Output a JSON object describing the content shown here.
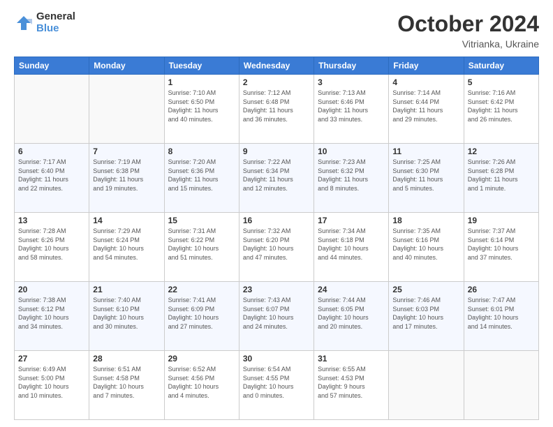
{
  "logo": {
    "general": "General",
    "blue": "Blue"
  },
  "header": {
    "month": "October 2024",
    "location": "Vitrianka, Ukraine"
  },
  "weekdays": [
    "Sunday",
    "Monday",
    "Tuesday",
    "Wednesday",
    "Thursday",
    "Friday",
    "Saturday"
  ],
  "weeks": [
    [
      {
        "day": "",
        "info": ""
      },
      {
        "day": "",
        "info": ""
      },
      {
        "day": "1",
        "info": "Sunrise: 7:10 AM\nSunset: 6:50 PM\nDaylight: 11 hours\nand 40 minutes."
      },
      {
        "day": "2",
        "info": "Sunrise: 7:12 AM\nSunset: 6:48 PM\nDaylight: 11 hours\nand 36 minutes."
      },
      {
        "day": "3",
        "info": "Sunrise: 7:13 AM\nSunset: 6:46 PM\nDaylight: 11 hours\nand 33 minutes."
      },
      {
        "day": "4",
        "info": "Sunrise: 7:14 AM\nSunset: 6:44 PM\nDaylight: 11 hours\nand 29 minutes."
      },
      {
        "day": "5",
        "info": "Sunrise: 7:16 AM\nSunset: 6:42 PM\nDaylight: 11 hours\nand 26 minutes."
      }
    ],
    [
      {
        "day": "6",
        "info": "Sunrise: 7:17 AM\nSunset: 6:40 PM\nDaylight: 11 hours\nand 22 minutes."
      },
      {
        "day": "7",
        "info": "Sunrise: 7:19 AM\nSunset: 6:38 PM\nDaylight: 11 hours\nand 19 minutes."
      },
      {
        "day": "8",
        "info": "Sunrise: 7:20 AM\nSunset: 6:36 PM\nDaylight: 11 hours\nand 15 minutes."
      },
      {
        "day": "9",
        "info": "Sunrise: 7:22 AM\nSunset: 6:34 PM\nDaylight: 11 hours\nand 12 minutes."
      },
      {
        "day": "10",
        "info": "Sunrise: 7:23 AM\nSunset: 6:32 PM\nDaylight: 11 hours\nand 8 minutes."
      },
      {
        "day": "11",
        "info": "Sunrise: 7:25 AM\nSunset: 6:30 PM\nDaylight: 11 hours\nand 5 minutes."
      },
      {
        "day": "12",
        "info": "Sunrise: 7:26 AM\nSunset: 6:28 PM\nDaylight: 11 hours\nand 1 minute."
      }
    ],
    [
      {
        "day": "13",
        "info": "Sunrise: 7:28 AM\nSunset: 6:26 PM\nDaylight: 10 hours\nand 58 minutes."
      },
      {
        "day": "14",
        "info": "Sunrise: 7:29 AM\nSunset: 6:24 PM\nDaylight: 10 hours\nand 54 minutes."
      },
      {
        "day": "15",
        "info": "Sunrise: 7:31 AM\nSunset: 6:22 PM\nDaylight: 10 hours\nand 51 minutes."
      },
      {
        "day": "16",
        "info": "Sunrise: 7:32 AM\nSunset: 6:20 PM\nDaylight: 10 hours\nand 47 minutes."
      },
      {
        "day": "17",
        "info": "Sunrise: 7:34 AM\nSunset: 6:18 PM\nDaylight: 10 hours\nand 44 minutes."
      },
      {
        "day": "18",
        "info": "Sunrise: 7:35 AM\nSunset: 6:16 PM\nDaylight: 10 hours\nand 40 minutes."
      },
      {
        "day": "19",
        "info": "Sunrise: 7:37 AM\nSunset: 6:14 PM\nDaylight: 10 hours\nand 37 minutes."
      }
    ],
    [
      {
        "day": "20",
        "info": "Sunrise: 7:38 AM\nSunset: 6:12 PM\nDaylight: 10 hours\nand 34 minutes."
      },
      {
        "day": "21",
        "info": "Sunrise: 7:40 AM\nSunset: 6:10 PM\nDaylight: 10 hours\nand 30 minutes."
      },
      {
        "day": "22",
        "info": "Sunrise: 7:41 AM\nSunset: 6:09 PM\nDaylight: 10 hours\nand 27 minutes."
      },
      {
        "day": "23",
        "info": "Sunrise: 7:43 AM\nSunset: 6:07 PM\nDaylight: 10 hours\nand 24 minutes."
      },
      {
        "day": "24",
        "info": "Sunrise: 7:44 AM\nSunset: 6:05 PM\nDaylight: 10 hours\nand 20 minutes."
      },
      {
        "day": "25",
        "info": "Sunrise: 7:46 AM\nSunset: 6:03 PM\nDaylight: 10 hours\nand 17 minutes."
      },
      {
        "day": "26",
        "info": "Sunrise: 7:47 AM\nSunset: 6:01 PM\nDaylight: 10 hours\nand 14 minutes."
      }
    ],
    [
      {
        "day": "27",
        "info": "Sunrise: 6:49 AM\nSunset: 5:00 PM\nDaylight: 10 hours\nand 10 minutes."
      },
      {
        "day": "28",
        "info": "Sunrise: 6:51 AM\nSunset: 4:58 PM\nDaylight: 10 hours\nand 7 minutes."
      },
      {
        "day": "29",
        "info": "Sunrise: 6:52 AM\nSunset: 4:56 PM\nDaylight: 10 hours\nand 4 minutes."
      },
      {
        "day": "30",
        "info": "Sunrise: 6:54 AM\nSunset: 4:55 PM\nDaylight: 10 hours\nand 0 minutes."
      },
      {
        "day": "31",
        "info": "Sunrise: 6:55 AM\nSunset: 4:53 PM\nDaylight: 9 hours\nand 57 minutes."
      },
      {
        "day": "",
        "info": ""
      },
      {
        "day": "",
        "info": ""
      }
    ]
  ]
}
